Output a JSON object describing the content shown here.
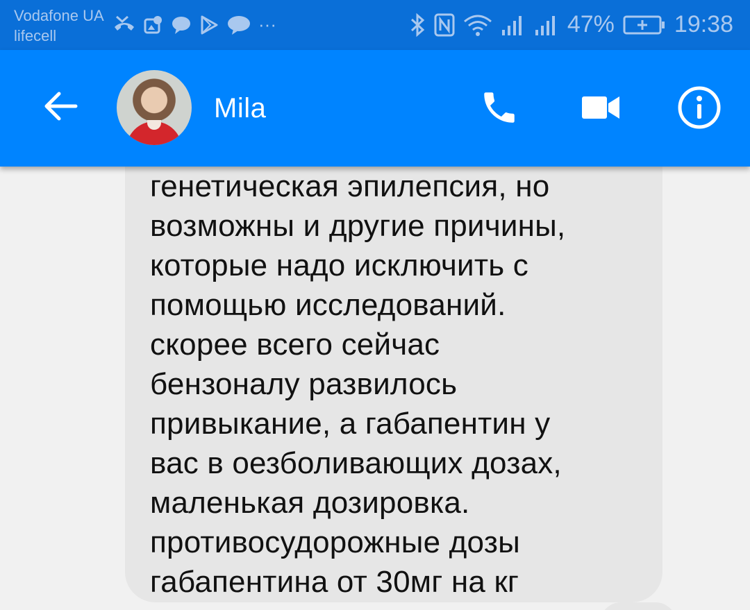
{
  "status_bar": {
    "carrier_primary": "Vodafone UA",
    "carrier_secondary": "lifecell",
    "notification_icons": [
      "missed-call-icon",
      "photo-map-icon",
      "chat-bubble-icon",
      "play-store-icon",
      "chat-bubble-icon"
    ],
    "more_indicator": "···",
    "battery_percent": "47%",
    "time": "19:38"
  },
  "toolbar": {
    "contact_name": "Mila"
  },
  "message": {
    "lines": [
      "генетическая эпилепсия, но",
      "возможны и другие причины,",
      "которые надо исключить с",
      "помощью исследований.",
      "скорее всего сейчас",
      "бензоналу развилось",
      "привыкание, а габапентин у",
      "вас в оезболивающих дозах,",
      "маленькая дозировка.",
      "противосудорожные дозы",
      "габапентина от 30мг на кг"
    ]
  },
  "colors": {
    "status_bar": "#0a6fd8",
    "toolbar": "#0084ff",
    "background": "#f1f1f1",
    "bubble": "#e6e6e6",
    "text": "#111111"
  }
}
